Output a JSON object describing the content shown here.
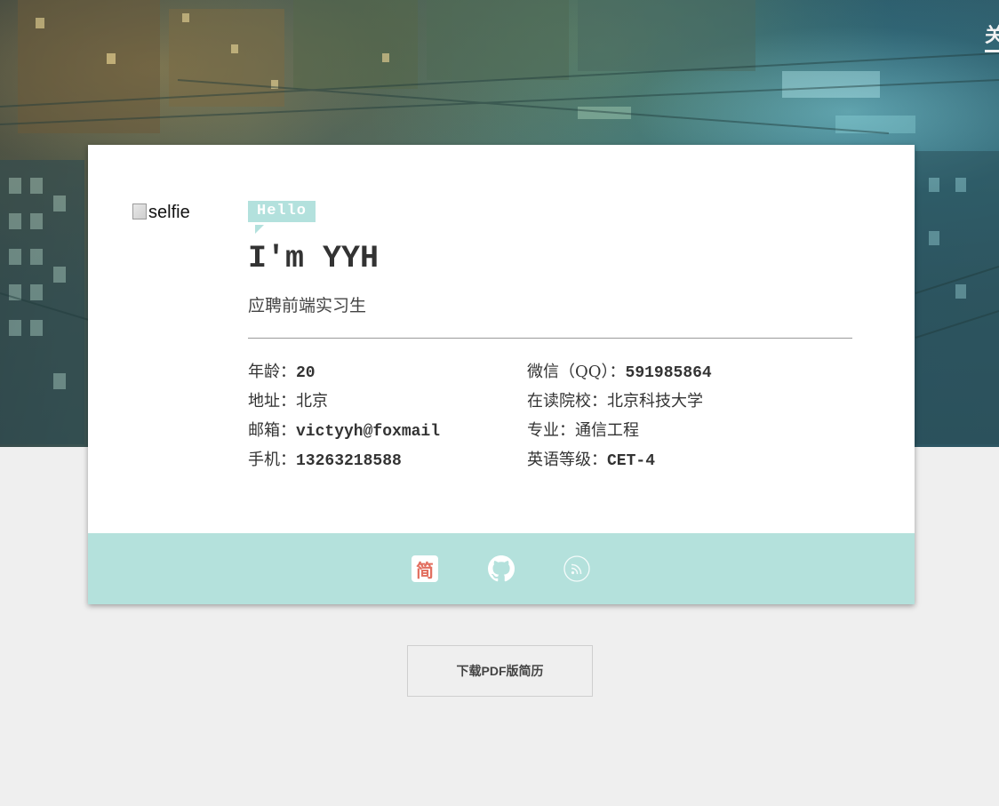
{
  "nav": {
    "partial_label": "关"
  },
  "profile": {
    "selfie_alt": "selfie",
    "greeting": "Hello",
    "name": "I'm YYH",
    "subtitle": "应聘前端实习生"
  },
  "info": {
    "left": [
      {
        "key": "年龄：",
        "value": "20"
      },
      {
        "key": "地址：",
        "value": "北京"
      },
      {
        "key": "邮箱：",
        "value": "victyyh@foxmail"
      },
      {
        "key": "手机：",
        "value": "13263218588"
      }
    ],
    "right": [
      {
        "key": "微信（QQ）：",
        "value": "591985864"
      },
      {
        "key": "在读院校：",
        "value": "北京科技大学"
      },
      {
        "key": "专业：",
        "value": "通信工程"
      },
      {
        "key": "英语等级：",
        "value": "CET-4"
      }
    ]
  },
  "social": {
    "jianshu_label": "简",
    "icons": [
      "jianshu-icon",
      "github-icon",
      "rss-icon"
    ]
  },
  "download_button": {
    "label": "下载PDF版简历"
  },
  "colors": {
    "accent": "#b3e1dd",
    "jianshu_red": "#e26f60",
    "page_bg": "#efefef",
    "text": "#333333"
  }
}
